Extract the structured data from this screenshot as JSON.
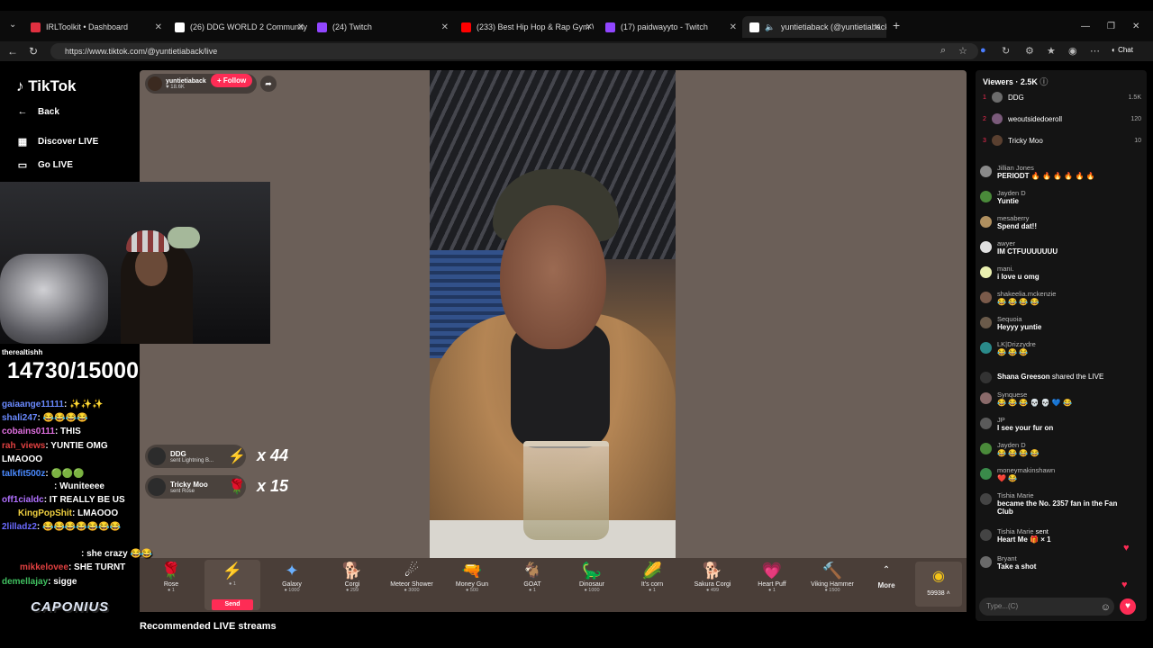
{
  "browser": {
    "tabs": [
      {
        "label": "IRLToolkit • Dashboard",
        "color": "#e03040"
      },
      {
        "label": "(26) DDG WORLD 2 Community /",
        "color": "#ffffff"
      },
      {
        "label": "(24) Twitch",
        "color": "#9146ff"
      },
      {
        "label": "(233) Best Hip Hop & Rap Gym W",
        "color": "#ff0000"
      },
      {
        "label": "(17) paidwayyto - Twitch",
        "color": "#9146ff"
      },
      {
        "label": "yuntietiaback (@yuntietiaback",
        "color": "#ffffff"
      }
    ],
    "new_tab": "+",
    "url": "https://www.tiktok.com/@yuntietiaback/live",
    "chat_btn": "Chat"
  },
  "sidebar": {
    "logo": "TikTok",
    "back": "Back",
    "discover": "Discover LIVE",
    "golive": "Go LIVE"
  },
  "host": {
    "name": "yuntietiaback",
    "likes": "♥ 18.6K",
    "follow": "+ Follow"
  },
  "gift_notifications": [
    {
      "name": "DDG",
      "sub": "sent Lightning B...",
      "icon": "⚡",
      "combo": "x 44"
    },
    {
      "name": "Tricky Moo",
      "sub": "sent Rose",
      "icon": "🌹",
      "combo": "x 15"
    }
  ],
  "gifts": [
    {
      "name": "Rose",
      "price": "1",
      "icon": "🌹"
    },
    {
      "name": "",
      "price": "1",
      "icon": "⚡"
    },
    {
      "name": "Galaxy",
      "price": "1000",
      "icon": "✦"
    },
    {
      "name": "Corgi",
      "price": "299",
      "icon": "🐕"
    },
    {
      "name": "Meteor Shower",
      "price": "3000",
      "icon": "☄"
    },
    {
      "name": "Money Gun",
      "price": "500",
      "icon": "🔫"
    },
    {
      "name": "GOAT",
      "price": "1",
      "icon": "🐐"
    },
    {
      "name": "Dinosaur",
      "price": "1000",
      "icon": "🦕"
    },
    {
      "name": "It's corn",
      "price": "1",
      "icon": "🌽"
    },
    {
      "name": "Sakura Corgi",
      "price": "499",
      "icon": "🐕"
    },
    {
      "name": "Heart Puff",
      "price": "1",
      "icon": "💗"
    },
    {
      "name": "Viking Hammer",
      "price": "1500",
      "icon": "🔨"
    }
  ],
  "send_label": "Send",
  "more_label": "More",
  "coins": "59938",
  "recommended": "Recommended LIVE streams",
  "viewers": {
    "title": "Viewers · 2.5K",
    "top": [
      {
        "rank": "1",
        "name": "DDG",
        "count": "1.5K",
        "color": "#6c6c6c"
      },
      {
        "rank": "2",
        "name": "weoutsidedoeroll",
        "count": "120",
        "color": "#7a5a7a"
      },
      {
        "rank": "3",
        "name": "Tricky Moo",
        "count": "10",
        "color": "#5a4030"
      }
    ]
  },
  "chat": [
    {
      "user": "Jillian Jones",
      "text": "PERIODT 🔥 🔥 🔥 🔥 🔥 🔥",
      "color": "#8a8a8a"
    },
    {
      "user": "Jayden D",
      "text": "Yuntie",
      "color": "#4a8a3a"
    },
    {
      "user": "mesaberry",
      "text": "Spend dat!!",
      "color": "#b09060"
    },
    {
      "user": "awyer",
      "text": "IM CTFUUUUUUU",
      "color": "#e0e0e0"
    },
    {
      "user": "mani.",
      "text": "i love u omg",
      "color": "#eaf0b0"
    },
    {
      "user": "shakeelia.mckenzie",
      "text": "😂 😂 😂 😂",
      "color": "#7a5a4a"
    },
    {
      "user": "Sequoia",
      "text": "Heyyy yuntie",
      "color": "#6a5a4a"
    },
    {
      "user": "LK|Drizzydre",
      "text": "😂 😂 😂",
      "color": "#2a8a8a"
    },
    {
      "user": "Shana Greeson",
      "text": "shared the LIVE",
      "color": "#333333"
    },
    {
      "user": "Synquese",
      "text": "😂 😂 😂 💀 💀 💙 😂",
      "color": "#8a6a6a"
    },
    {
      "user": "JP",
      "text": "I see your fur on",
      "color": "#5a5a5a"
    },
    {
      "user": "Jayden D",
      "text": "😂 😂 😂 😂",
      "color": "#4a8a3a"
    },
    {
      "user": "moneymakinshawn",
      "text": "❤️ 😂",
      "color": "#3a8a4a"
    },
    {
      "user": "Tishia Marie",
      "text": "became the No. 2357 fan in the Fan Club",
      "color": "#444444"
    },
    {
      "user": "Tishia Marie",
      "text": "Heart Me 🎁 × 1",
      "color": "#444444"
    },
    {
      "user": "Bryant",
      "text": "Take a shot",
      "color": "#6a6a6a"
    }
  ],
  "chat_input": "Type...(C)",
  "overlay": {
    "counter": "14730/15000",
    "brand": "CAPONIUS",
    "lines": [
      {
        "u": "therealtishh",
        "t": ""
      },
      {
        "u": "gaiaange11111",
        "t": ": ✨✨✨"
      },
      {
        "u": "shali247",
        "t": ": 😂😂😂😂"
      },
      {
        "u": "cobains0111",
        "t": ": THIS"
      },
      {
        "u": "rah_views",
        "t": ": YUNTIE OMG"
      },
      {
        "u": "",
        "t": "LMAOOO"
      },
      {
        "u": "talkfit500z",
        "t": ": 🟢🟢🟢"
      },
      {
        "u": "",
        "t": ": Wuniteeee"
      },
      {
        "u": "off1cialdc",
        "t": ": IT REALLY BE US"
      },
      {
        "u": "KingPopShit",
        "t": ": LMAOOO"
      },
      {
        "u": "2lilladz2",
        "t": ": 😂😂😂😂😂😂😂"
      },
      {
        "u": "",
        "t": ": she crazy 😂😂"
      },
      {
        "u": "mikkelovee",
        "t": ": SHE TURNT"
      },
      {
        "u": "demellajay",
        "t": ": sigge"
      }
    ]
  }
}
